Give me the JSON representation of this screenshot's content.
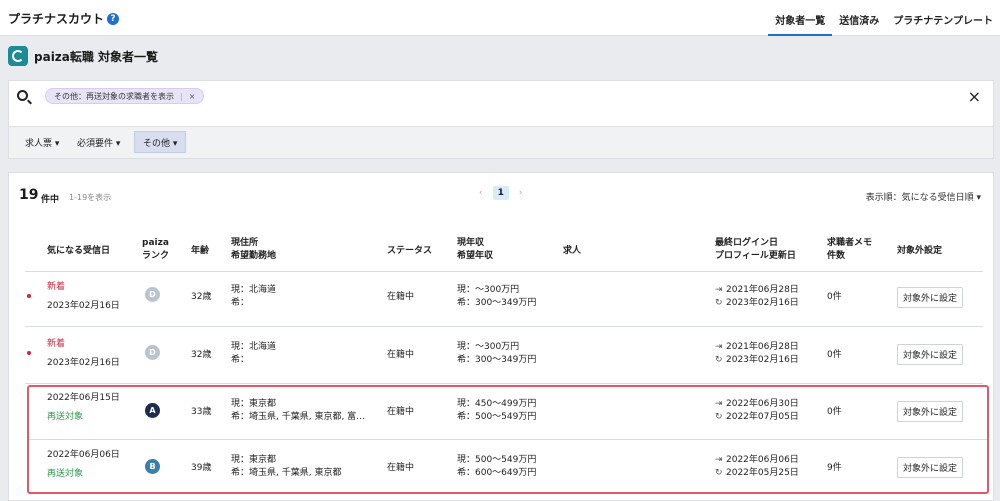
{
  "header": {
    "brand": "プラチナスカウト",
    "help_glyph": "?",
    "nav": [
      "対象者一覧",
      "送信済み",
      "プラチナテンプレート"
    ]
  },
  "page": {
    "title": "paiza転職 対象者一覧"
  },
  "search": {
    "chip_label": "その他：再送対象の求職者を表示",
    "chip_remove": "×",
    "close": "×"
  },
  "filters": {
    "items": [
      "求人票 ▾",
      "必須要件 ▾",
      "その他 ▾"
    ]
  },
  "list": {
    "count": "19",
    "count_unit": "件中",
    "range": "1-19を表示",
    "pager": {
      "prev": "‹",
      "current": "1",
      "next": "›"
    },
    "sort": "表示順：気になる受信日順 ▾",
    "columns": {
      "received": "気になる受信日",
      "rank": [
        "paiza",
        "ランク"
      ],
      "age": "年齢",
      "location": [
        "現住所",
        "希望勤務地"
      ],
      "status": "ステータス",
      "salary": [
        "現年収",
        "希望年収"
      ],
      "job": "求人",
      "login": [
        "最終ログイン日",
        "プロフィール更新日"
      ],
      "memo": [
        "求職者メモ",
        "件数"
      ],
      "exclude": "対象外設定"
    },
    "rows": [
      {
        "tag": "新着",
        "tag_type": "new",
        "date": "2023年02月16日",
        "rank": "D",
        "rank_color": "#b9c4d2",
        "age": "32歳",
        "loc_now": "現：北海道",
        "loc_want": "希：",
        "status": "在籍中",
        "sal_now": "現：〜300万円",
        "sal_want": "希：300〜349万円",
        "login": "2021年06月28日",
        "updated": "2023年02月16日",
        "memo": "0件",
        "btn": "対象外に設定"
      },
      {
        "tag": "新着",
        "tag_type": "new",
        "date": "2023年02月16日",
        "rank": "D",
        "rank_color": "#b9c4d2",
        "age": "32歳",
        "loc_now": "現：北海道",
        "loc_want": "希：",
        "status": "在籍中",
        "sal_now": "現：〜300万円",
        "sal_want": "希：300〜349万円",
        "login": "2021年06月28日",
        "updated": "2023年02月16日",
        "memo": "0件",
        "btn": "対象外に設定"
      },
      {
        "tag": "再送対象",
        "tag_type": "resend",
        "date": "2022年06月15日",
        "rank": "A",
        "rank_color": "#1d2d52",
        "age": "33歳",
        "loc_now": "現：東京都",
        "loc_want": "希：埼玉県, 千葉県, 東京都, 富…",
        "status": "在籍中",
        "sal_now": "現：450〜499万円",
        "sal_want": "希：500〜549万円",
        "login": "2022年06月30日",
        "updated": "2022年07月05日",
        "memo": "0件",
        "btn": "対象外に設定"
      },
      {
        "tag": "再送対象",
        "tag_type": "resend",
        "date": "2022年06月06日",
        "rank": "B",
        "rank_color": "#3a7fae",
        "age": "39歳",
        "loc_now": "現：東京都",
        "loc_want": "希：埼玉県, 千葉県, 東京都",
        "status": "在籍中",
        "sal_now": "現：500〜549万円",
        "sal_want": "希：600〜649万円",
        "login": "2022年06月06日",
        "updated": "2022年05月25日",
        "memo": "9件",
        "btn": "対象外に設定"
      }
    ]
  }
}
